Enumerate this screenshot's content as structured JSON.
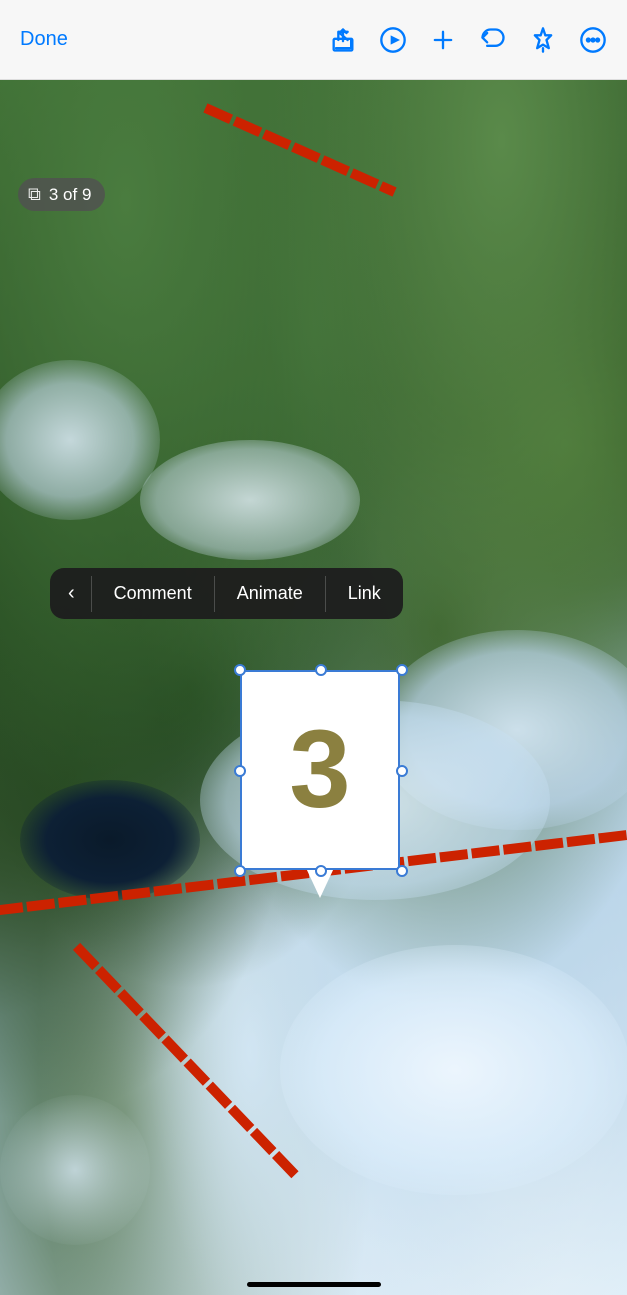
{
  "toolbar": {
    "done_label": "Done",
    "page_indicator": "3 of 9",
    "icons": {
      "share": "share-icon",
      "play": "play-icon",
      "add": "add-icon",
      "undo": "undo-icon",
      "pin": "pin-icon",
      "more": "more-icon"
    }
  },
  "context_menu": {
    "back_label": "‹",
    "items": [
      "Comment",
      "Animate",
      "Link"
    ]
  },
  "selected_element": {
    "number": "3"
  },
  "colors": {
    "accent": "#007AFF",
    "selection": "#3a7bd5",
    "number_color": "#8b8040",
    "menu_bg": "rgba(30,30,30,0.95)",
    "badge_bg": "rgba(80,80,80,0.82)"
  }
}
